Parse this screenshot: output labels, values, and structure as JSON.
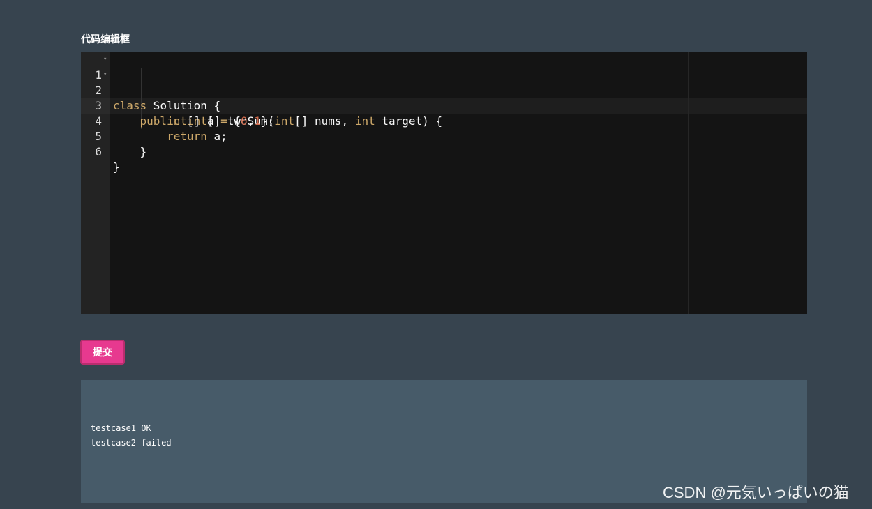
{
  "editor": {
    "label": "代码编辑框",
    "lines": [
      {
        "number": "1",
        "tokens": {
          "kw1": "class",
          "t1": " Solution {"
        }
      },
      {
        "number": "2",
        "tokens": {
          "indent": "    ",
          "kw1": "public",
          "t1": " ",
          "kw2": "int",
          "t2": "[] twoSum(",
          "kw3": "int",
          "t3": "[] nums, ",
          "kw4": "int",
          "t4": " target) {"
        }
      },
      {
        "number": "3",
        "tokens": {
          "indent": "        ",
          "kw1": "int",
          "t1": "[] a ",
          "op": "=",
          "t2": " {",
          "n1": "0",
          "t3": ",",
          "n2": "1",
          "t4": "};"
        }
      },
      {
        "number": "4",
        "tokens": {
          "indent": "        ",
          "kw1": "return",
          "t1": " a;"
        }
      },
      {
        "number": "5",
        "tokens": {
          "indent": "    ",
          "t1": "}"
        }
      },
      {
        "number": "6",
        "tokens": {
          "t1": "}"
        }
      }
    ]
  },
  "submit_button": {
    "label": "提交"
  },
  "output": {
    "lines": [
      "testcase1 OK",
      "testcase2 failed"
    ]
  },
  "watermark": "CSDN @元気いっぱいの猫",
  "colors": {
    "page_background": "#37444f",
    "editor_background": "#141414",
    "keyword": "#cda869",
    "number": "#cf6a4c",
    "submit_button": "#e7398f",
    "output_background": "#475b69"
  },
  "icons": {
    "fold_marker": "fold-arrow-icon"
  }
}
